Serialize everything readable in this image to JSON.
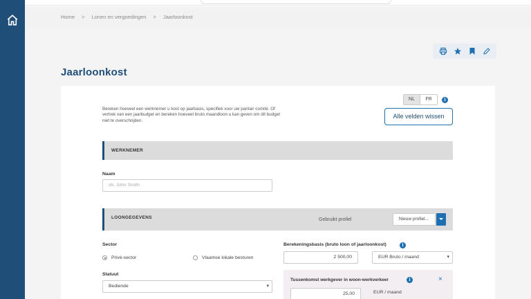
{
  "breadcrumb": [
    "Home",
    "Lonen en vergoedingen",
    "Jaarloonkost"
  ],
  "breadcrumb_separator": ">",
  "page_title": "Jaarloonkost",
  "intro_text": "Bereken hoeveel een werknemer u kost op jaarbasis, specifiek voor uw paritair comité. Of vertrek van een jaarbudget en bereken hoeveel bruto maandloon u kan geven om dit budget niet te overschrijden.",
  "language": {
    "options": [
      "NL",
      "FR"
    ],
    "selected": "NL"
  },
  "clear_button": "Alle velden wissen",
  "sections": {
    "werknemer": "WERKNEMER",
    "loongegevens": "LOONGEGEVENS"
  },
  "naam": {
    "label": "Naam",
    "placeholder": "vb.  John Smith"
  },
  "profiel": {
    "label": "Gebruikt profiel",
    "value": "Nieuw profiel..."
  },
  "sector": {
    "label": "Sector",
    "options": [
      "Privé-sector",
      "Vlaamse lokale besturen"
    ],
    "selected": "Privé-sector"
  },
  "statuut": {
    "label": "Statuut",
    "value": "Bediende"
  },
  "berekeningsbasis": {
    "label": "Berekeningsbasis (bruto loon of jaarloonkost)",
    "amount": "2 500,00",
    "unit": "EUR Bruto / maand"
  },
  "tussenkomst": {
    "label": "Tussenkomst werkgever in woon-werkverkeer",
    "amount": "25,00",
    "unit": "EUR / maand",
    "close": "×"
  },
  "colors": {
    "brand": "#1f4e79",
    "accent": "#1f6fb3"
  },
  "tool_icons": [
    "print-icon",
    "star-icon",
    "bookmark-icon",
    "edit-icon"
  ]
}
